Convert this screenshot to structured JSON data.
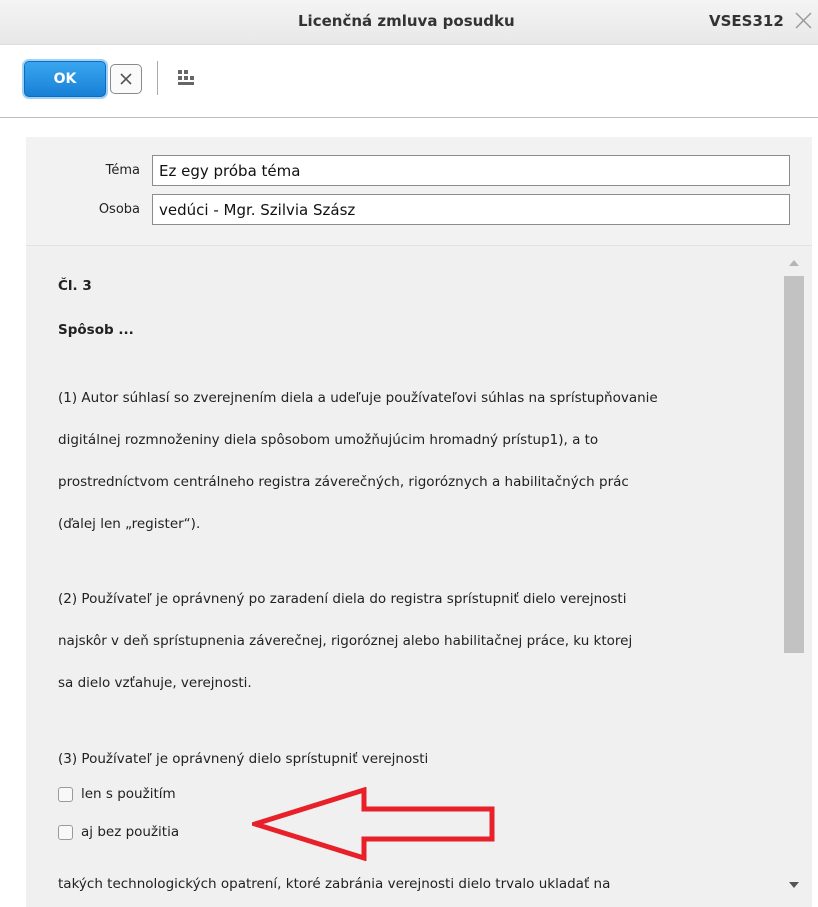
{
  "window": {
    "title": "Licenčná zmluva posudku",
    "code": "VSES312"
  },
  "toolbar": {
    "ok_label": "OK"
  },
  "fields": [
    {
      "label": "Téma",
      "value": "Ez egy próba téma"
    },
    {
      "label": "Osoba",
      "value": "vedúci - Mgr. Szilvia Szász"
    }
  ],
  "document": {
    "article": "Čl. 3",
    "heading": "Spôsob ...",
    "para1": [
      "(1) Autor súhlasí so zverejnením diela a udeľuje používateľovi súhlas na sprístupňovanie",
      "digitálnej rozmnoženiny diela spôsobom umožňujúcim hromadný prístup1), a to",
      "prostredníctvom centrálneho registra záverečných, rigoróznych a habilitačných prác",
      "(ďalej len „register“)."
    ],
    "para2": [
      "(2) Používateľ je oprávnený po zaradení diela do registra sprístupniť dielo verejnosti",
      "najskôr v deň sprístupnenia záverečnej, rigoróznej alebo habilitačnej práce, ku ktorej",
      "sa dielo vzťahuje, verejnosti."
    ],
    "para3_intro": "(3) Používateľ je oprávnený dielo sprístupniť verejnosti",
    "options": [
      {
        "label": "len s použitím",
        "checked": false
      },
      {
        "label": "aj bez použitia",
        "checked": false
      }
    ],
    "para3_tail": "takých technologických opatrení, ktoré zabránia verejnosti dielo trvalo ukladať na"
  },
  "colors": {
    "ok_button": "#1780d6",
    "annotation_arrow": "#e8202a"
  },
  "icons": {
    "close": "close-icon",
    "cancel": "x-icon",
    "tree": "tree-structure-icon",
    "scroll_up": "scroll-up-arrow-icon",
    "scroll_down": "scroll-down-arrow-icon"
  }
}
